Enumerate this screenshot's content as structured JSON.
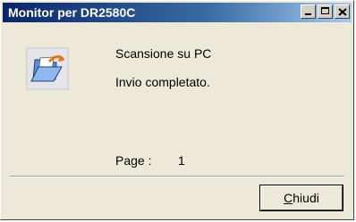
{
  "window": {
    "title": "Monitor per DR2580C"
  },
  "content": {
    "line1": "Scansione su PC",
    "line2": "Invio completato.",
    "page_label": "Page :",
    "page_value": "1"
  },
  "buttons": {
    "close_first": "C",
    "close_rest": "hiudi"
  },
  "icons": {
    "main": "open-folder-icon",
    "minimize": "minimize-icon",
    "maximize": "maximize-icon",
    "close": "close-icon"
  },
  "colors": {
    "titlebar_start": "#0a246a",
    "titlebar_end": "#a6caf0",
    "window_bg": "#ece9d8"
  }
}
